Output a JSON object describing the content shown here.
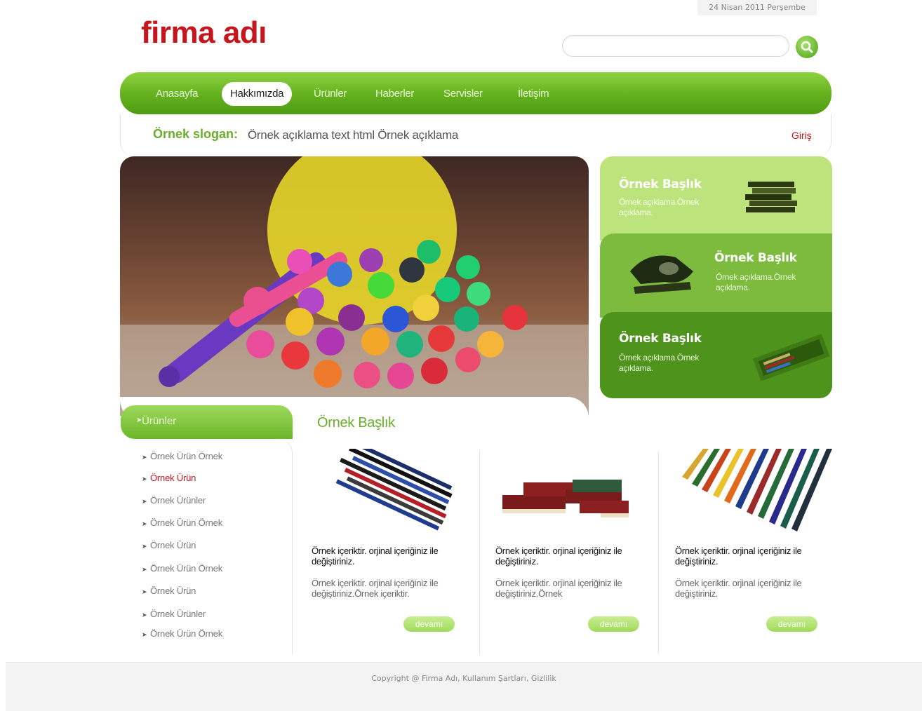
{
  "header": {
    "date": "24 Nisan 2011 Perşembe",
    "logo": "firma adı",
    "search_placeholder": ""
  },
  "nav": {
    "items": [
      {
        "label": "Anasayfa"
      },
      {
        "label": "Hakkımızda"
      },
      {
        "label": "Ürünler"
      },
      {
        "label": "Haberler"
      },
      {
        "label": "Servisler"
      },
      {
        "label": "İletişim"
      }
    ],
    "active": "Hakkımızda"
  },
  "slogan": {
    "title": "Örnek slogan:",
    "text": "Örnek açıklama text html Örnek açıklama",
    "login": "Giriş"
  },
  "features": [
    {
      "title": "Örnek Başlık",
      "desc": "Örnek açıklama.Örnek açıklama."
    },
    {
      "title": "Örnek Başlık",
      "desc": "Örnek açıklama.Örnek açıklama."
    },
    {
      "title": "Örnek Başlık",
      "desc": "Örnek açıklama.Örnek açıklama."
    }
  ],
  "sidebar": {
    "title": "Ürünler",
    "items": [
      {
        "label": "Örnek Ürün Örnek"
      },
      {
        "label": "Örnek Ürün"
      },
      {
        "label": "Örnek Ürünler"
      },
      {
        "label": "Örnek Ürün Örnek"
      },
      {
        "label": "Örnek Ürün"
      },
      {
        "label": "Örnek Ürün Örnek"
      },
      {
        "label": "Örnek Ürün"
      },
      {
        "label": "Örnek Ürünler"
      },
      {
        "label": "Örnek Ürün Örnek"
      }
    ],
    "active_index": 1
  },
  "main": {
    "title": "Örnek Başlık",
    "products": [
      {
        "text1": "Örnek içeriktir. orjinal içeriğiniz ile değiştiriniz.",
        "text2": "Örnek içeriktir. orjinal içeriğiniz ile değiştiriniz.Örnek içeriktir.",
        "button": "devamı"
      },
      {
        "text1": "Örnek içeriktir. orjinal içeriğiniz ile değiştiriniz.",
        "text2": "Örnek içeriktir. orjinal içeriğiniz ile değiştiriniz.Örnek",
        "button": "devamı"
      },
      {
        "text1": "Örnek içeriktir. orjinal içeriğiniz ile değiştiriniz.",
        "text2": "Örnek içeriktir. orjinal içeriğiniz ile değiştiriniz.",
        "button": "devamı"
      }
    ]
  },
  "footer": {
    "text": "Copyright @ Firma Adı, Kullanım Şartları, Gizlilik"
  },
  "colors": {
    "brand_red": "#c4161c",
    "accent_green": "#6aad2d",
    "nav_green": "#66b320"
  },
  "icons": {
    "search": "search-icon",
    "arrow": "chevron-right-icon"
  }
}
